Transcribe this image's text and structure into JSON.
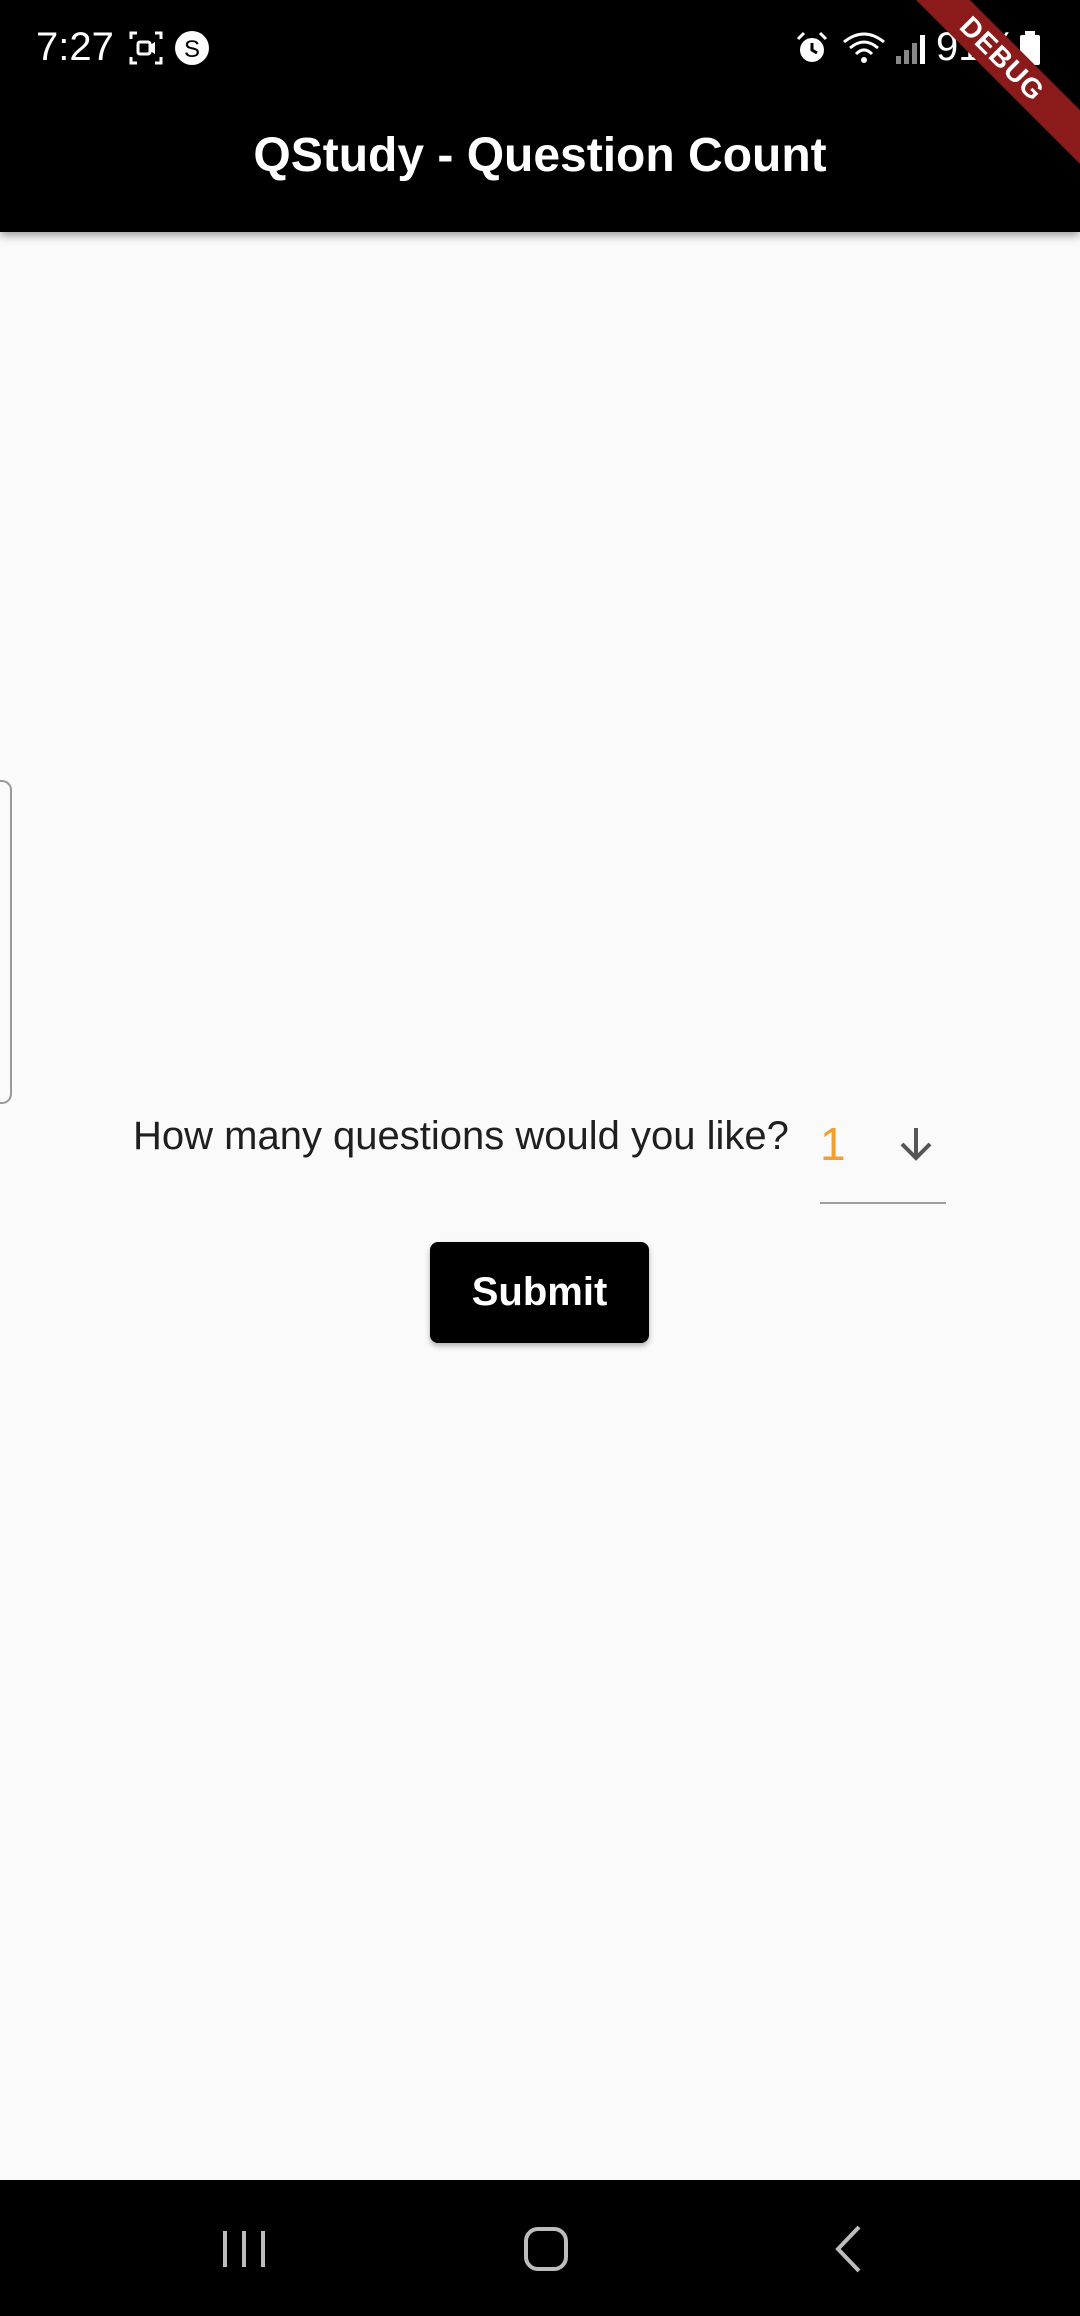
{
  "status_bar": {
    "time": "7:27",
    "battery": "91%",
    "icons": [
      "screen-record-icon",
      "shazam-icon",
      "alarm-icon",
      "wifi-icon",
      "signal-icon",
      "battery-icon"
    ]
  },
  "debug_banner": "DEBUG",
  "app_bar": {
    "title": "QStudy - Question Count"
  },
  "main": {
    "question_label": "How many questions would you like?",
    "dropdown": {
      "selected_value": "1",
      "value_color": "#f0a030"
    },
    "submit_label": "Submit"
  },
  "nav_bar": {
    "buttons": [
      "recent-apps-icon",
      "home-icon",
      "back-icon"
    ]
  },
  "colors": {
    "app_bar": "#000000",
    "background": "#fafafa",
    "accent": "#f0a030",
    "debug": "#8b1a1a"
  }
}
